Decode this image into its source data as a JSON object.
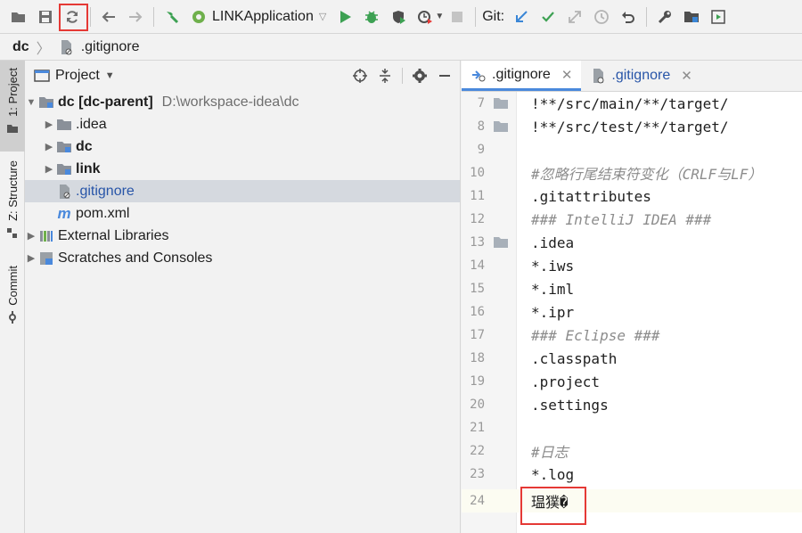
{
  "toolbar": {
    "run_config": "LINKApplication",
    "git_label": "Git:",
    "buttons": [
      "open-folder",
      "save-all",
      "synchronize",
      "back",
      "forward",
      "build",
      "run",
      "debug",
      "coverage",
      "profile",
      "stop",
      "git-update",
      "git-commit",
      "git-pull-requests",
      "git-history",
      "git-rollback",
      "settings",
      "project-structure",
      "run-anything"
    ]
  },
  "breadcrumb": {
    "root": "dc",
    "file": ".gitignore"
  },
  "side_tabs": {
    "project": "1: Project",
    "structure": "Z: Structure",
    "commit": "Commit"
  },
  "project_panel": {
    "title": "Project",
    "tree": [
      {
        "label": "dc [dc-parent]",
        "suffix": "D:\\workspace-idea\\dc"
      },
      {
        "label": ".idea"
      },
      {
        "label": "dc"
      },
      {
        "label": "link"
      },
      {
        "label": ".gitignore"
      },
      {
        "label": "pom.xml"
      },
      {
        "label": "External Libraries"
      },
      {
        "label": "Scratches and Consoles"
      }
    ]
  },
  "editor": {
    "tabs": [
      {
        "label": ".gitignore"
      },
      {
        "label": ".gitignore"
      }
    ],
    "lines": [
      {
        "num": "7",
        "text": "!**/src/main/**/target/"
      },
      {
        "num": "8",
        "text": "!**/src/test/**/target/"
      },
      {
        "num": "9",
        "text": ""
      },
      {
        "num": "10",
        "text": "#忽略行尾结束符变化（CRLF与LF）"
      },
      {
        "num": "11",
        "text": ".gitattributes"
      },
      {
        "num": "12",
        "text": "### IntelliJ IDEA ###"
      },
      {
        "num": "13",
        "text": ".idea"
      },
      {
        "num": "14",
        "text": "*.iws"
      },
      {
        "num": "15",
        "text": "*.iml"
      },
      {
        "num": "16",
        "text": "*.ipr"
      },
      {
        "num": "17",
        "text": "### Eclipse ###"
      },
      {
        "num": "18",
        "text": ".classpath"
      },
      {
        "num": "19",
        "text": ".project"
      },
      {
        "num": "20",
        "text": ".settings"
      },
      {
        "num": "21",
        "text": ""
      },
      {
        "num": "22",
        "text": "#日志"
      },
      {
        "num": "23",
        "text": "*.log"
      },
      {
        "num": "24",
        "text": "瑥獛�"
      }
    ]
  },
  "colors": {
    "accent": "#4a89dc",
    "highlight": "#e53935",
    "run_green": "#3da153"
  }
}
